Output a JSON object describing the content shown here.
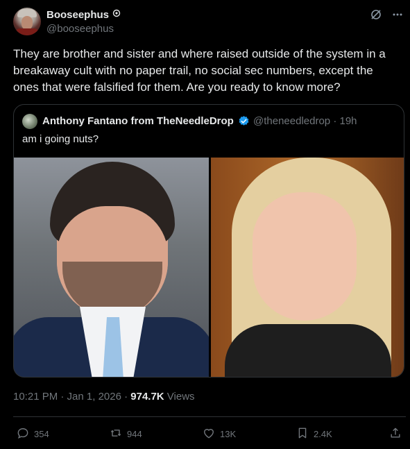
{
  "author": {
    "display_name": "Booseephus",
    "handle": "@booseephus",
    "badge_icon": "circle-badge-icon"
  },
  "tweet": {
    "text": "They are brother and sister and where raised outside of the system in a breakaway cult with no paper trail, no social sec numbers, except the ones that were falsified for them. Are you ready to know more?"
  },
  "quoted": {
    "display_name": "Anthony Fantano from TheNeedleDrop",
    "handle_time": "@theneedledrop · 19h",
    "text": "am i going nuts?",
    "verified_color": "#1d9bf0"
  },
  "meta": {
    "time": "10:21 PM · Jan 1, 2026 · ",
    "views_count": "974.7K",
    "views_label": " Views"
  },
  "actions": {
    "replies": "354",
    "reposts": "944",
    "likes": "13K",
    "bookmarks": "2.4K"
  },
  "colors": {
    "background": "#000000",
    "text": "#e7e9ea",
    "muted": "#71767b",
    "border": "#2f3336"
  }
}
